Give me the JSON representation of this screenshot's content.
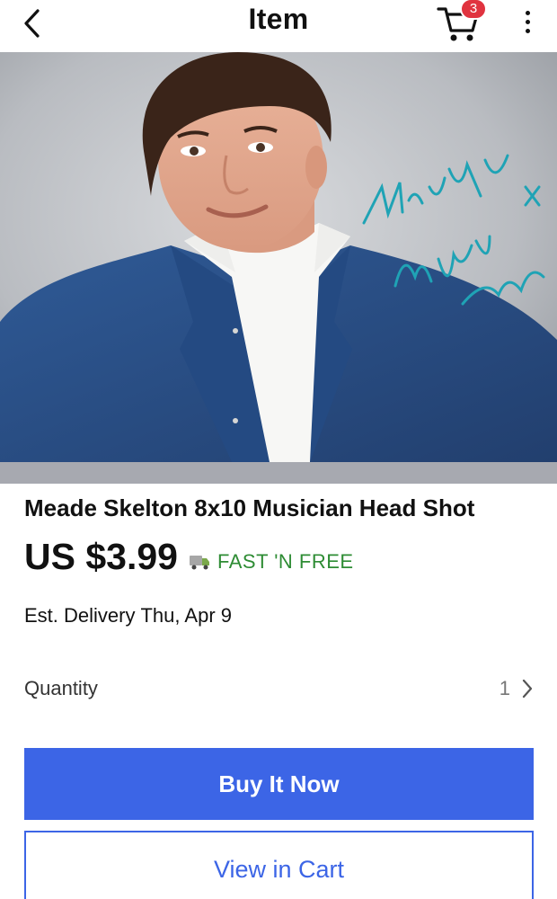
{
  "header": {
    "title": "Item",
    "cart_count": "3"
  },
  "hero": {
    "signature_lines": [
      "Musically Yours",
      "Meade",
      "Skelton",
      "X"
    ]
  },
  "item": {
    "title": "Meade Skelton 8x10 Musician Head Shot",
    "price": "US $3.99",
    "shipping": "FAST 'N FREE",
    "delivery_label": "Est. Delivery",
    "delivery_date": "Thu, Apr 9"
  },
  "quantity": {
    "label": "Quantity",
    "value": "1"
  },
  "actions": {
    "buy_now": "Buy It Now",
    "view_in_cart": "View in Cart"
  },
  "colors": {
    "primary": "#3c65e6",
    "badge": "#e0333f",
    "shipping_green": "#2e8c34",
    "signature": "#1fa3b5"
  },
  "icons": {
    "back": "chevron-left-icon",
    "cart": "shopping-cart-icon",
    "more": "more-vertical-icon",
    "truck": "delivery-truck-icon",
    "quantity_chevron": "chevron-right-icon"
  }
}
